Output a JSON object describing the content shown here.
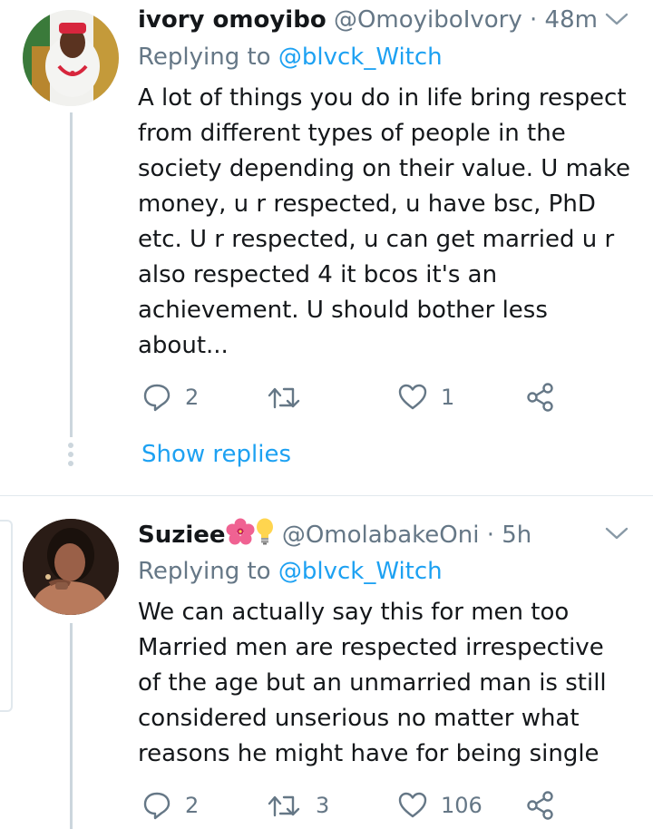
{
  "tweets": [
    {
      "name": "ivory omoyibo",
      "handle": "@OmoyiboIvory",
      "dot": "·",
      "time": "48m",
      "reply_prefix": "Replying to",
      "reply_to": "@blvck_Witch",
      "lines": [
        "A lot of things you do in life bring respect",
        "from different types of people in the",
        "society depending on their value. U make",
        "money, u r respected, u have bsc, PhD",
        "etc. U r respected, u can get married u r",
        "also respected 4 it bcos it's an",
        "achievement. U should bother less",
        "about..."
      ],
      "replies": "2",
      "retweets": "",
      "likes": "1",
      "show_replies": "Show replies"
    },
    {
      "name": "Suziee",
      "handle": "@OmolabakeOni",
      "dot": "·",
      "time": "5h",
      "reply_prefix": "Replying to",
      "reply_to": "@blvck_Witch",
      "lines": [
        "We can actually say this for men too",
        "Married men are respected irrespective",
        "of the age but an unmarried man is still",
        "considered unserious no matter what",
        "reasons he might have for being single"
      ],
      "replies": "2",
      "retweets": "3",
      "likes": "106"
    }
  ],
  "icons": {
    "reply": "reply-icon",
    "retweet": "retweet-icon",
    "like": "heart-icon",
    "share": "share-icon",
    "more": "chevron-down-icon"
  },
  "colors": {
    "link": "#1da1f2",
    "muted": "#657786",
    "text": "#14171a",
    "thread_line": "#ccd6dd"
  }
}
